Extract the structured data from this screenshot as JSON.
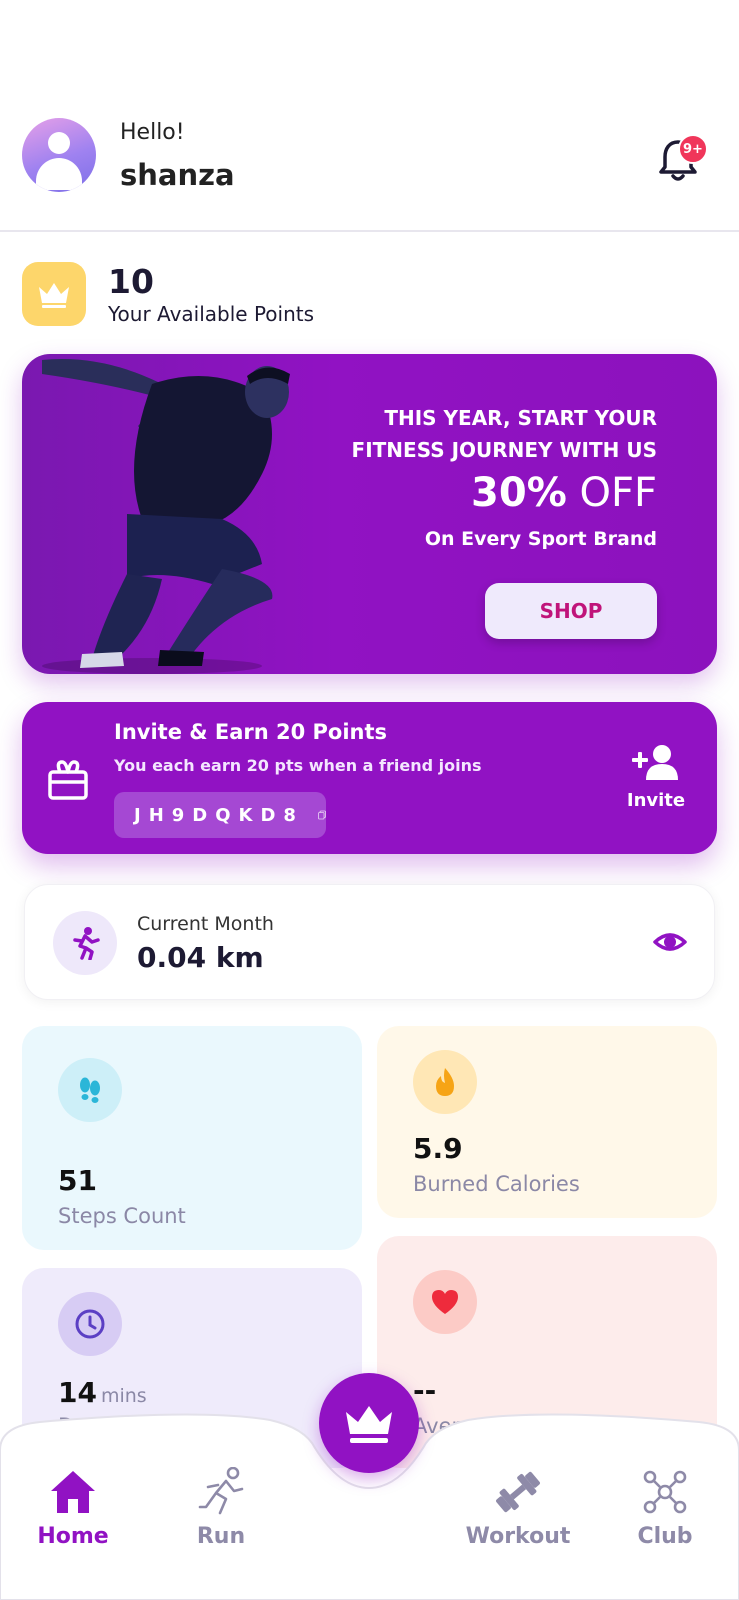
{
  "header": {
    "greeting": "Hello!",
    "username": "shanza",
    "notification_badge": "9+"
  },
  "points": {
    "value": "10",
    "label": "Your Available Points"
  },
  "banner": {
    "headline_line1": "THIS YEAR, START YOUR",
    "headline_line2": "FITNESS JOURNEY WITH US",
    "discount_bold": "30%",
    "discount_text": "OFF",
    "subtitle": "On Every Sport Brand",
    "shop_label": "SHOP"
  },
  "invite": {
    "title": "Invite & Earn 20 Points",
    "description": "You each earn 20 pts when a friend joins",
    "code": "JH9DQKD8",
    "action_label": "Invite"
  },
  "month": {
    "label": "Current Month",
    "value": "0.04 km"
  },
  "stats": {
    "steps": {
      "value": "51",
      "label": "Steps Count"
    },
    "calories": {
      "value": "5.9",
      "label": "Burned Calories"
    },
    "duration": {
      "value": "14",
      "unit": "mins",
      "label": "Duration"
    },
    "bpm": {
      "value": "--",
      "label": "Average BPM"
    }
  },
  "nav": {
    "home": "Home",
    "run": "Run",
    "workout": "Workout",
    "club": "Club"
  },
  "colors": {
    "accent": "#9112c3",
    "points_icon_bg": "#fdd66b",
    "badge": "#f0365a",
    "inactive_nav": "#8e8aa8"
  }
}
